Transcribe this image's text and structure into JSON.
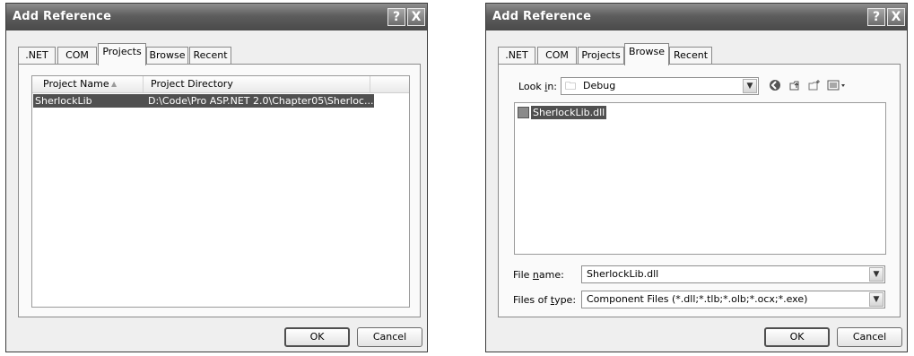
{
  "left_dialog": {
    "title": "Add Reference",
    "help_btn": "?",
    "close_btn": "X",
    "tabs": [
      ".NET",
      "COM",
      "Projects",
      "Browse",
      "Recent"
    ],
    "active_tab": "Projects",
    "columns": [
      "Project Name",
      "Project Directory"
    ],
    "sort_indicator": "▲",
    "rows": [
      {
        "name": "SherlockLib",
        "directory": "D:\\Code\\Pro ASP.NET 2.0\\Chapter05\\Sherloc..."
      }
    ],
    "ok_label": "OK",
    "cancel_label": "Cancel"
  },
  "right_dialog": {
    "title": "Add Reference",
    "help_btn": "?",
    "close_btn": "X",
    "tabs": [
      ".NET",
      "COM",
      "Projects",
      "Browse",
      "Recent"
    ],
    "active_tab": "Browse",
    "look_in_label_pre": "Look ",
    "look_in_label_u": "i",
    "look_in_label_post": "n:",
    "look_in_value": "Debug",
    "files": [
      "SherlockLib.dll"
    ],
    "file_name_label_pre": "File ",
    "file_name_label_u": "n",
    "file_name_label_post": "ame:",
    "file_name_value": "SherlockLib.dll",
    "files_of_type_label_pre": "Files of ",
    "files_of_type_label_u": "t",
    "files_of_type_label_post": "ype:",
    "files_of_type_value": "Component Files (*.dll;*.tlb;*.olb;*.ocx;*.exe)",
    "ok_label": "OK",
    "cancel_label": "Cancel"
  },
  "icons": {
    "back": "back-icon",
    "up": "up-folder-icon",
    "new_folder": "new-folder-icon",
    "views": "views-menu-icon"
  }
}
